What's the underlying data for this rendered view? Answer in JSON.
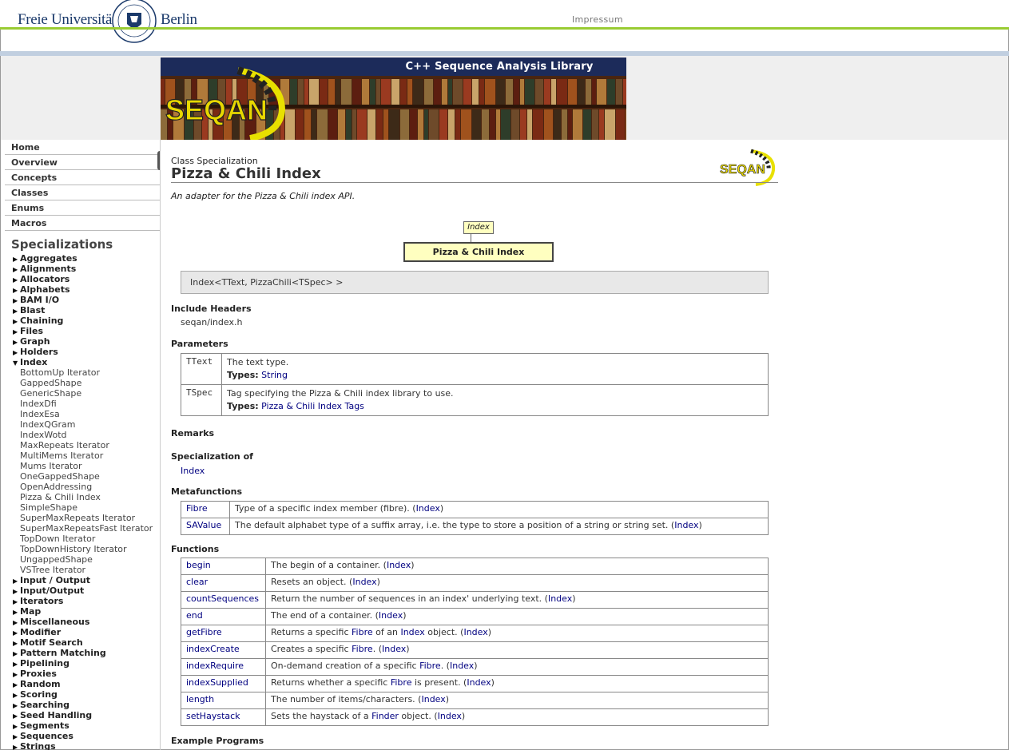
{
  "header": {
    "wordmark_left": "Freie Universität",
    "wordmark_right": "Berlin",
    "impressum": "Impressum"
  },
  "banner": {
    "title": "C++ Sequence Analysis Library",
    "logo_text": "SEQAN"
  },
  "sidebar": {
    "top_items": [
      "Home",
      "Overview",
      "Concepts",
      "Classes",
      "Enums",
      "Macros"
    ],
    "specializations_heading": "Specializations",
    "categories_before": [
      "Aggregates",
      "Alignments",
      "Allocators",
      "Alphabets",
      "BAM I/O",
      "Blast",
      "Chaining",
      "Files",
      "Graph",
      "Holders"
    ],
    "expanded_category": "Index",
    "expanded_items": [
      "BottomUp Iterator",
      "GappedShape",
      "GenericShape",
      "IndexDfi",
      "IndexEsa",
      "IndexQGram",
      "IndexWotd",
      "MaxRepeats Iterator",
      "MultiMems Iterator",
      "Mums Iterator",
      "OneGappedShape",
      "OpenAddressing",
      "Pizza & Chili Index",
      "SimpleShape",
      "SuperMaxRepeats Iterator",
      "SuperMaxRepeatsFast Iterator",
      "TopDown Iterator",
      "TopDownHistory Iterator",
      "UngappedShape",
      "VSTree Iterator"
    ],
    "categories_after": [
      "Input / Output",
      "Input/Output",
      "Iterators",
      "Map",
      "Miscellaneous",
      "Modifier",
      "Motif Search",
      "Pattern Matching",
      "Pipelining",
      "Proxies",
      "Random",
      "Scoring",
      "Searching",
      "Seed Handling",
      "Segments",
      "Sequences",
      "Strings"
    ]
  },
  "main": {
    "kind_label": "Class Specialization",
    "title": "Pizza & Chili Index",
    "summary": "An adapter for the Pizza & Chili index API.",
    "diagram": {
      "parent": "Index",
      "node": "Pizza & Chili Index"
    },
    "signature": "Index<TText, PizzaChili<TSpec> >",
    "include_headers_heading": "Include Headers",
    "include_header": "seqan/index.h",
    "parameters_heading": "Parameters",
    "types_label": "Types:",
    "parameters": [
      {
        "name": "TText",
        "desc": "The text type.",
        "types": "String"
      },
      {
        "name": "TSpec",
        "desc": "Tag specifying the Pizza & Chili index library to use.",
        "types": "Pizza & Chili Index Tags"
      }
    ],
    "remarks_heading": "Remarks",
    "specialization_of_heading": "Specialization of",
    "specialization_of": "Index",
    "metafunctions_heading": "Metafunctions",
    "metafunctions": [
      {
        "name": "Fibre",
        "desc": "Type of a specific index member (fibre).",
        "ref": "Index"
      },
      {
        "name": "SAValue",
        "desc": "The default alphabet type of a suffix array, i.e. the type to store a position of a string or string set.",
        "ref": "Index"
      }
    ],
    "functions_heading": "Functions",
    "functions": [
      {
        "name": "begin",
        "parts": [
          "The begin of a container."
        ],
        "ref": "Index"
      },
      {
        "name": "clear",
        "parts": [
          "Resets an object."
        ],
        "ref": "Index"
      },
      {
        "name": "countSequences",
        "parts": [
          "Return the number of sequences in an index' underlying text."
        ],
        "ref": "Index"
      },
      {
        "name": "end",
        "parts": [
          "The end of a container."
        ],
        "ref": "Index"
      },
      {
        "name": "getFibre",
        "parts": [
          "Returns a specific ",
          "@Fibre",
          " of an ",
          "@Index",
          " object."
        ],
        "ref": "Index"
      },
      {
        "name": "indexCreate",
        "parts": [
          "Creates a specific ",
          "@Fibre",
          "."
        ],
        "ref": "Index"
      },
      {
        "name": "indexRequire",
        "parts": [
          "On-demand creation of a specific ",
          "@Fibre",
          "."
        ],
        "ref": "Index"
      },
      {
        "name": "indexSupplied",
        "parts": [
          "Returns whether a specific ",
          "@Fibre",
          " is present."
        ],
        "ref": "Index"
      },
      {
        "name": "length",
        "parts": [
          "The number of items/characters."
        ],
        "ref": "Index"
      },
      {
        "name": "setHaystack",
        "parts": [
          "Sets the haystack of a ",
          "@Finder",
          " object."
        ],
        "ref": "Index"
      }
    ],
    "example_programs_heading": "Example Programs"
  }
}
